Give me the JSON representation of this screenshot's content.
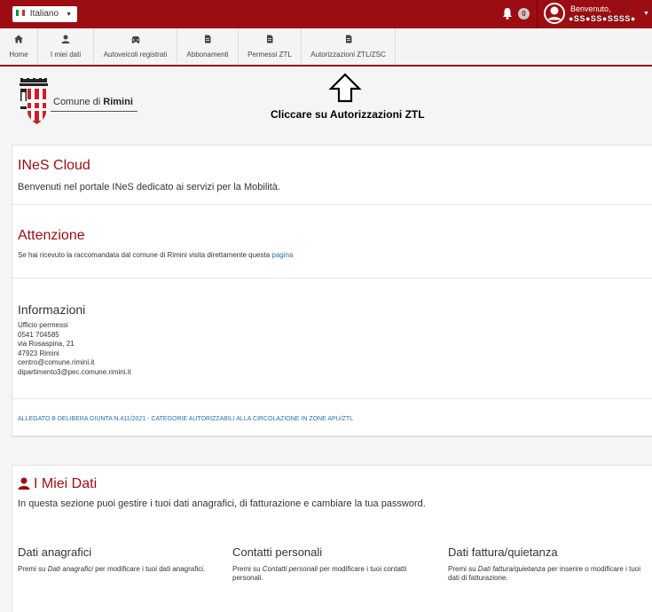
{
  "topbar": {
    "language": "Italiano",
    "notification_count": "0",
    "welcome": "Benvenuto,",
    "username": "●SS●SS●SSSS●",
    "colors": {
      "bar": "#9b0d12"
    }
  },
  "nav": {
    "items": [
      {
        "label": "Home",
        "icon": "home-icon"
      },
      {
        "label": "I miei dati",
        "icon": "user-icon"
      },
      {
        "label": "Autoveicoli registrati",
        "icon": "car-icon"
      },
      {
        "label": "Abbonamenti",
        "icon": "document-icon"
      },
      {
        "label": "Permessi ZTL",
        "icon": "document-icon"
      },
      {
        "label": "Autorizzazioni ZTL/ZSC",
        "icon": "document-icon"
      }
    ]
  },
  "header": {
    "comune_prefix": "Comune di",
    "comune_name": "Rimini",
    "instruction": "Cliccare su Autorizzazioni ZTL"
  },
  "ines": {
    "title": "INeS Cloud",
    "text": "Benvenuti nel portale INeS dedicato ai servizi per la Mobilità."
  },
  "attenzione": {
    "title": "Attenzione",
    "text": "Se hai ricevuto la raccomandata dal comune di Rimini visita direttamente questa",
    "link": "pagina"
  },
  "informazioni": {
    "title": "Informazioni",
    "lines": [
      "Ufficio permessi",
      "0541 704585",
      "via Rosaspina, 21",
      "47923 Rimini",
      "centro@comune.rimini.it",
      "dipartimento3@pec.comune.rimini.it"
    ]
  },
  "allegato": "ALLEGATO B DELIBERA GIUNTA N.411/2021 - CATEGORIE AUTORIZZABILI ALLA CIRCOLAZIONE IN ZONE APU/ZTL",
  "miei_dati": {
    "title": "I Miei Dati",
    "text": "In questa sezione puoi gestire i tuoi dati anagrafici, di fatturazione e cambiare la tua password.",
    "columns": [
      {
        "title": "Dati anagrafici",
        "pre": "Premi su ",
        "em": "Dati anagrafici",
        "post": " per modificare i tuoi dati anagrafici."
      },
      {
        "title": "Contatti personali",
        "pre": "Premi su ",
        "em": "Contatti personali",
        "post": " per modificare i tuoi contatti personali."
      },
      {
        "title": "Dati fattura/quietanza",
        "pre": "Premi su ",
        "em": "Dati fattura/quietanza",
        "post": " per inserire o modificare i tuoi dati di fatturazione."
      }
    ]
  }
}
